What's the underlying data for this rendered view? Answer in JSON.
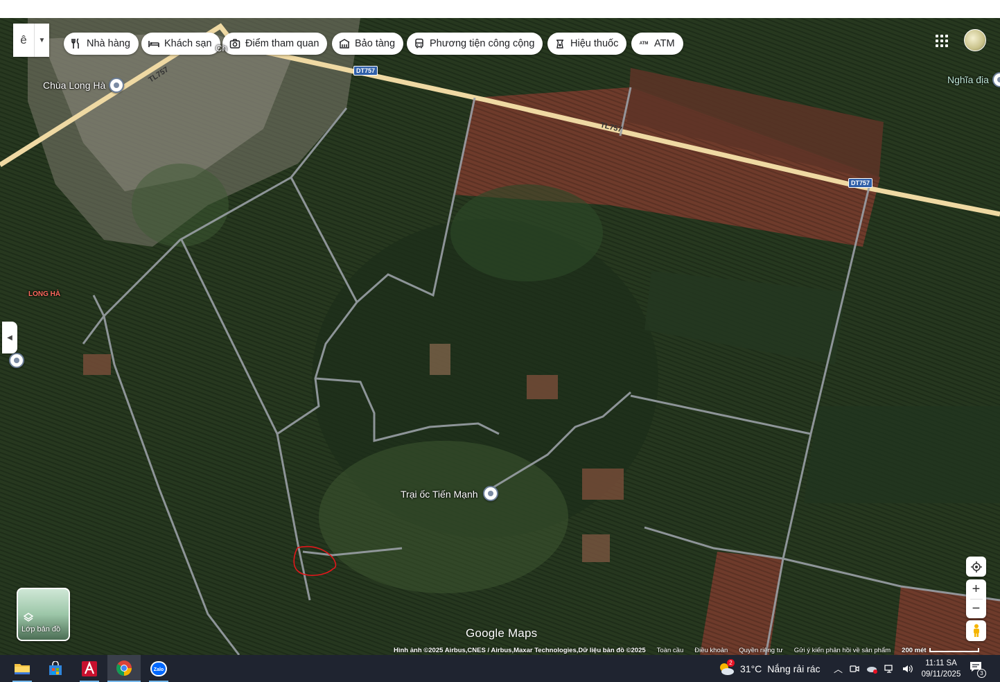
{
  "search": {
    "letter": "ê"
  },
  "chips": [
    {
      "label": "Nhà hàng",
      "icon": "restaurant-icon"
    },
    {
      "label": "Khách sạn",
      "icon": "hotel-bed-icon"
    },
    {
      "label": "Điểm tham quan",
      "icon": "camera-icon"
    },
    {
      "label": "Bảo tàng",
      "icon": "museum-icon"
    },
    {
      "label": "Phương tiện công cộng",
      "icon": "bus-icon"
    },
    {
      "label": "Hiệu thuốc",
      "icon": "pharmacy-icon"
    },
    {
      "label": "ATM",
      "icon": "atm-icon"
    }
  ],
  "map": {
    "labels": {
      "pagoda": "Chùa Long Hà",
      "cemetery": "Nghĩa địa",
      "commune": "LONG HÀ",
      "farm": "Trại ốc Tiến Mạnh",
      "cut_label": "Ch"
    },
    "roads": {
      "tl757_a": "TL757",
      "tl757_b": "TL757",
      "dt757_a": "DT757",
      "dt757_b": "DT757"
    },
    "layers_label": "Lớp bản đồ",
    "logo": "Google Maps",
    "attribution": {
      "imagery": "Hình ảnh ©2025 Airbus,CNES / Airbus,Maxar Technologies,Dữ liệu bản đồ ©2025",
      "global": "Toàn cầu",
      "terms": "Điều khoản",
      "privacy": "Quyền riêng tư",
      "feedback": "Gửi ý kiến phản hồi về sản phẩm",
      "scale": "200 mét"
    },
    "colors": {
      "road_main": "#efd9a3",
      "road_minor": "#9aa0a6",
      "markup": "#e3161b",
      "field_red": "#6e3b2b"
    }
  },
  "taskbar": {
    "apps": [
      {
        "name": "file-explorer",
        "icon": "folder-icon"
      },
      {
        "name": "store",
        "icon": "store-icon"
      },
      {
        "name": "autocad",
        "icon": "autocad-icon"
      },
      {
        "name": "chrome",
        "icon": "chrome-icon"
      },
      {
        "name": "zalo",
        "icon": "zalo-icon"
      }
    ],
    "weather": {
      "temp": "31°C",
      "desc": "Nắng rải rác",
      "badge": "2"
    },
    "time": "11:11 SA",
    "date": "09/11/2025",
    "notif_count": "3"
  }
}
